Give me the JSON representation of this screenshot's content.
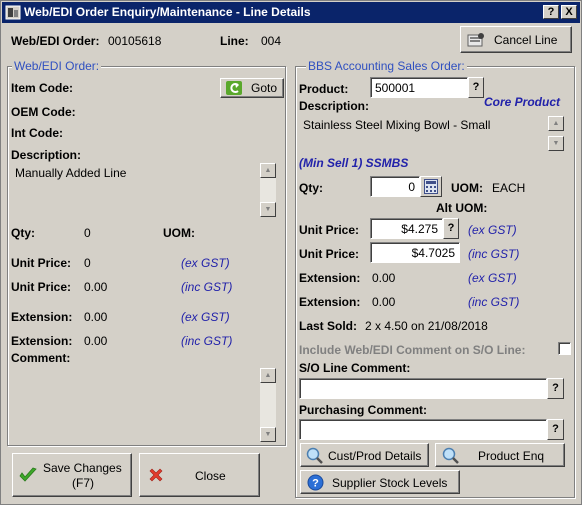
{
  "window": {
    "title": "Web/EDI Order Enquiry/Maintenance - Line Details",
    "help_btn": "?",
    "close_btn": "X"
  },
  "header": {
    "order_label": "Web/EDI Order:",
    "order_value": "00105618",
    "line_label": "Line:",
    "line_value": "004",
    "cancel_line_label": "Cancel Line"
  },
  "left": {
    "group_title": "Web/EDI Order:",
    "item_code_label": "Item Code:",
    "goto_label": "Goto",
    "oem_code_label": "OEM Code:",
    "int_code_label": "Int Code:",
    "description_label": "Description:",
    "description_value": "Manually Added Line",
    "qty_label": "Qty:",
    "qty_value": "0",
    "uom_label": "UOM:",
    "unit_price_label_1": "Unit Price:",
    "unit_price_value_1": "0",
    "unit_price_note_1": "(ex GST)",
    "unit_price_label_2": "Unit Price:",
    "unit_price_value_2": "0.00",
    "unit_price_note_2": "(inc GST)",
    "extension_label_1": "Extension:",
    "extension_value_1": "0.00",
    "extension_note_1": "(ex GST)",
    "extension_label_2": "Extension:",
    "extension_value_2": "0.00",
    "extension_note_2": "(inc GST)",
    "comment_label": "Comment:"
  },
  "right": {
    "group_title": "BBS Accounting Sales Order:",
    "product_label": "Product:",
    "product_value": "500001",
    "lookup_btn": "?",
    "core_product": "Core Product",
    "description_label": "Description:",
    "description_value": "Stainless Steel Mixing Bowl - Small",
    "min_sell": "(Min Sell 1) SSMBS",
    "qty_label": "Qty:",
    "qty_value": "0",
    "uom_label": "UOM:",
    "uom_value": "EACH",
    "alt_uom_label": "Alt UOM:",
    "unit_price_label_1": "Unit Price:",
    "unit_price_value_1": "$4.275",
    "unit_price_note_1": "(ex GST)",
    "unit_price_label_2": "Unit Price:",
    "unit_price_value_2": "$4.7025",
    "unit_price_note_2": "(inc GST)",
    "extension_label_1": "Extension:",
    "extension_value_1": "0.00",
    "extension_note_1": "(ex GST)",
    "extension_label_2": "Extension:",
    "extension_value_2": "0.00",
    "extension_note_2": "(inc GST)",
    "last_sold_label": "Last Sold:",
    "last_sold_value": "2 x 4.50 on 21/08/2018",
    "include_comment_label": "Include Web/EDI Comment on S/O Line:",
    "so_line_comment_label": "S/O Line Comment:",
    "so_line_comment_value": "",
    "purchasing_comment_label": "Purchasing Comment:",
    "purchasing_comment_value": "",
    "cust_prod_label": "Cust/Prod Details",
    "product_enq_label": "Product Enq",
    "supplier_stock_label": "Supplier Stock Levels"
  },
  "footer": {
    "save_label_1": "Save Changes",
    "save_label_2": "(F7)",
    "close_label": "Close"
  },
  "colors": {
    "title_bar": "#0a246a",
    "face": "#d4d0c8",
    "gst_note": "#2222aa",
    "group_header": "#3050c0"
  },
  "icons": [
    "window-app-icon",
    "help-icon",
    "close-icon",
    "cancel-line-icon",
    "goto-arrow-icon",
    "calendar-icon",
    "magnifier-icon",
    "help-circle-icon",
    "checkmark-icon",
    "x-icon"
  ]
}
